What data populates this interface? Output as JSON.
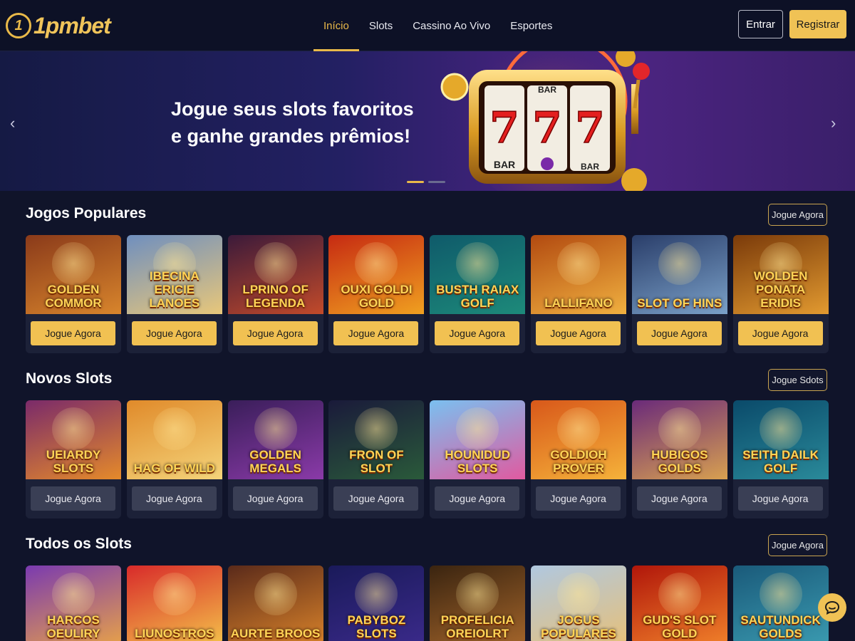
{
  "brand": {
    "mark": "1",
    "name": "1pmbet"
  },
  "nav": [
    {
      "label": "Início",
      "active": true
    },
    {
      "label": "Slots",
      "active": false
    },
    {
      "label": "Cassino Ao Vivo",
      "active": false
    },
    {
      "label": "Esportes",
      "active": false
    }
  ],
  "auth": {
    "login": "Entrar",
    "register": "Registrar"
  },
  "banner": {
    "title": "Jogue seus slots favoritos e ganhe grandes prêmios!",
    "reel_symbols": [
      "BAR",
      "BAR",
      "BAR"
    ],
    "slide_count": 2,
    "active_slide": 1
  },
  "sections": [
    {
      "title": "Jogos Populares",
      "action": "Jogue Agora",
      "button_style": "gold",
      "games": [
        {
          "name": "GOLDEN COMMOR",
          "cta": "Jogue Agora"
        },
        {
          "name": "IBECINA ERICIE LANOES",
          "cta": "Jogue Agora"
        },
        {
          "name": "LPRINO OF LEGENDA",
          "cta": "Jogue Agora"
        },
        {
          "name": "OUXI GOLDI GOLD",
          "cta": "Jogue Agora"
        },
        {
          "name": "BUSTH RAIAX GOLF",
          "cta": "Jogue Agora"
        },
        {
          "name": "LALLIFANO",
          "cta": "Jogue Agora"
        },
        {
          "name": "SLOT OF HINS",
          "cta": "Jogue Agora"
        },
        {
          "name": "WOLDEN PONATA ERIDIS",
          "cta": "Jogue Agora"
        }
      ]
    },
    {
      "title": "Novos Slots",
      "action": "Jogue Sdots",
      "button_style": "grey",
      "games": [
        {
          "name": "UEIARDY SLOTS",
          "cta": "Jogue Agora"
        },
        {
          "name": "HAG OF WILD",
          "cta": "Jogue Agora"
        },
        {
          "name": "GOLDEN MEGALS",
          "cta": "Jogue Agora"
        },
        {
          "name": "FRON OF SLOT",
          "cta": "Jogue Agora"
        },
        {
          "name": "HOUNIDUD SLOTS",
          "cta": "Jogue Agora"
        },
        {
          "name": "GOLDIOH PROVER",
          "cta": "Jogue Agora"
        },
        {
          "name": "HUBIGOS GOLDS",
          "cta": "Jogue Agora"
        },
        {
          "name": "SEITH DAILK GOLF",
          "cta": "Jogue Agora"
        }
      ]
    },
    {
      "title": "Todos os Slots",
      "action": "Jogue Agora",
      "button_style": "none",
      "games": [
        {
          "name": "HARCOS OEULIRY"
        },
        {
          "name": "LIUNOSTROS"
        },
        {
          "name": "AURTE BROOS"
        },
        {
          "name": "PABYBOZ SLOTS"
        },
        {
          "name": "PROFELICIA OREIOLRT"
        },
        {
          "name": "JOGUS POPULARES"
        },
        {
          "name": "GUD'S SLOT GOLD"
        },
        {
          "name": "SAUTUNDICK GOLDS"
        }
      ]
    }
  ],
  "colors": {
    "accent": "#f0c255",
    "background": "#10142a",
    "card": "#1c2138"
  },
  "icons": {
    "prev": "chevron-left-icon",
    "next": "chevron-right-icon",
    "chat": "chat-bubble-icon"
  }
}
